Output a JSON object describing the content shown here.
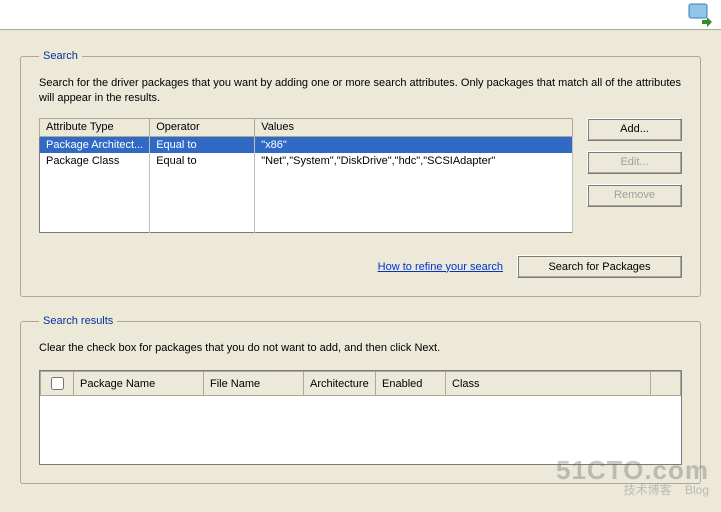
{
  "search_group": {
    "legend": "Search",
    "instructions": "Search for the driver packages that you want by adding one or more search attributes. Only packages that match all of the attributes will appear in the results.",
    "columns": {
      "attr": "Attribute Type",
      "op": "Operator",
      "val": "Values"
    },
    "rows": [
      {
        "attr": "Package Architect...",
        "op": "Equal to",
        "val": "\"x86\"",
        "selected": true
      },
      {
        "attr": "Package Class",
        "op": "Equal to",
        "val": "\"Net\",\"System\",\"DiskDrive\",\"hdc\",\"SCSIAdapter\"",
        "selected": false
      }
    ],
    "buttons": {
      "add": "Add...",
      "edit": "Edit...",
      "remove": "Remove"
    },
    "refine_link": "How to refine your search",
    "search_btn": "Search for Packages"
  },
  "results_group": {
    "legend": "Search results",
    "instructions": "Clear the check box for packages that you do not want to add, and then click Next.",
    "columns": {
      "name": "Package Name",
      "file": "File Name",
      "arch": "Architecture",
      "enabled": "Enabled",
      "class": "Class"
    }
  },
  "watermark": {
    "line1": "51CTO.com",
    "line2": "技术博客",
    "line3": "Blog"
  }
}
